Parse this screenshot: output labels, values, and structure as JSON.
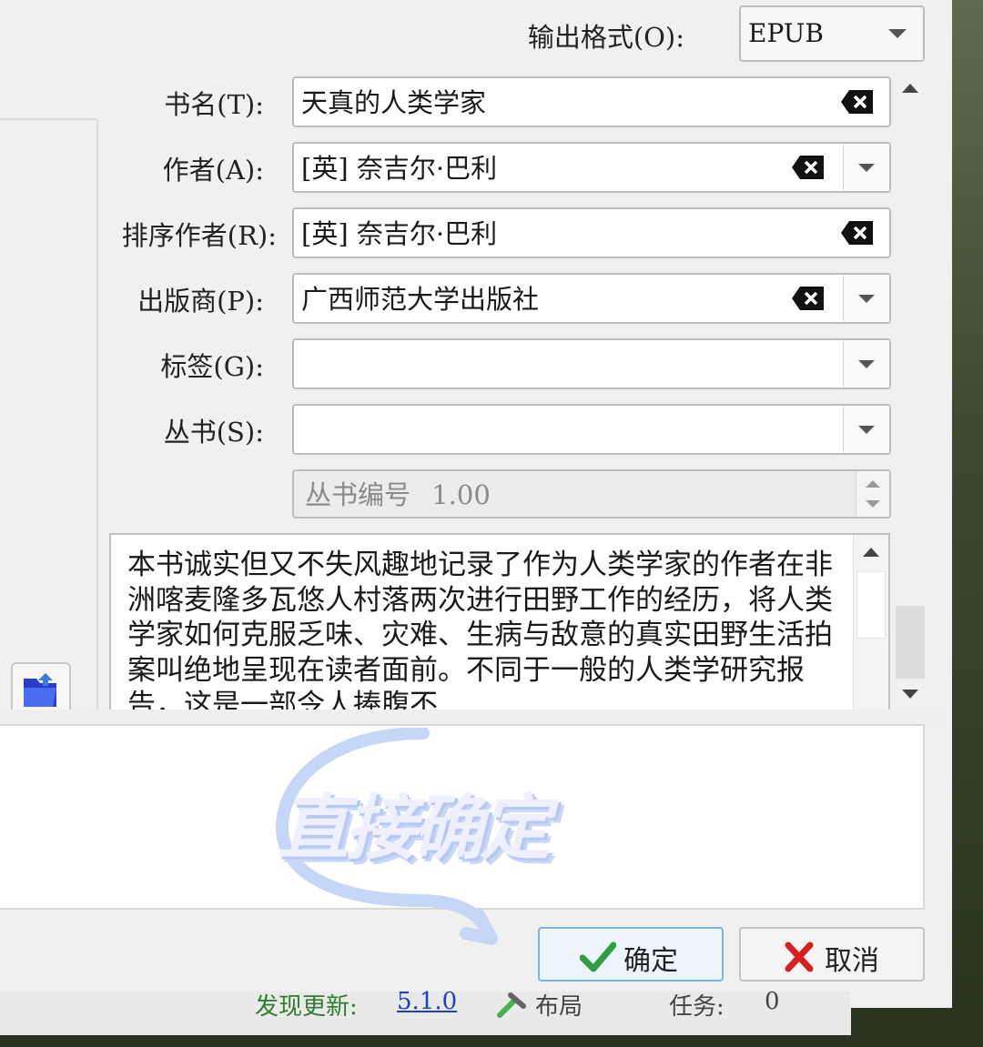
{
  "output_format": {
    "label": "输出格式(O):",
    "value": "EPUB"
  },
  "fields": {
    "title": {
      "label": "书名(T):",
      "value": "天真的人类学家"
    },
    "author": {
      "label": "作者(A):",
      "value": "[英] 奈吉尔·巴利"
    },
    "author_sort": {
      "label": "排序作者(R):",
      "value": "[英] 奈吉尔·巴利"
    },
    "publisher": {
      "label": "出版商(P):",
      "value": "广西师范大学出版社"
    },
    "tags": {
      "label": "标签(G):",
      "value": ""
    },
    "series": {
      "label": "丛书(S):",
      "value": ""
    },
    "series_index": {
      "label": "丛书编号",
      "value": "1.00"
    }
  },
  "comments": {
    "text": "本书诚实但又不失风趣地记录了作为人类学家的作者在非洲喀麦隆多瓦悠人村落两次进行田野工作的经历，将人类学家如何克服乏味、灾难、生病与敌意的真实田野生活拍案叫绝地呈现在读者面前。不同于一般的人类学研究报告，这是一部令人捧腹不"
  },
  "buttons": {
    "ok": "确定",
    "cancel": "取消"
  },
  "overlay": {
    "annotation": "直接确定"
  },
  "background_status": {
    "update_text": "发现更新:",
    "version": "5.1.0",
    "layout": "布局",
    "jobs": "任务:",
    "jobs_count": "0"
  },
  "colors": {
    "accent": "#7db2e4",
    "ok_check": "#2e9e3e",
    "cancel_x": "#d62020"
  }
}
